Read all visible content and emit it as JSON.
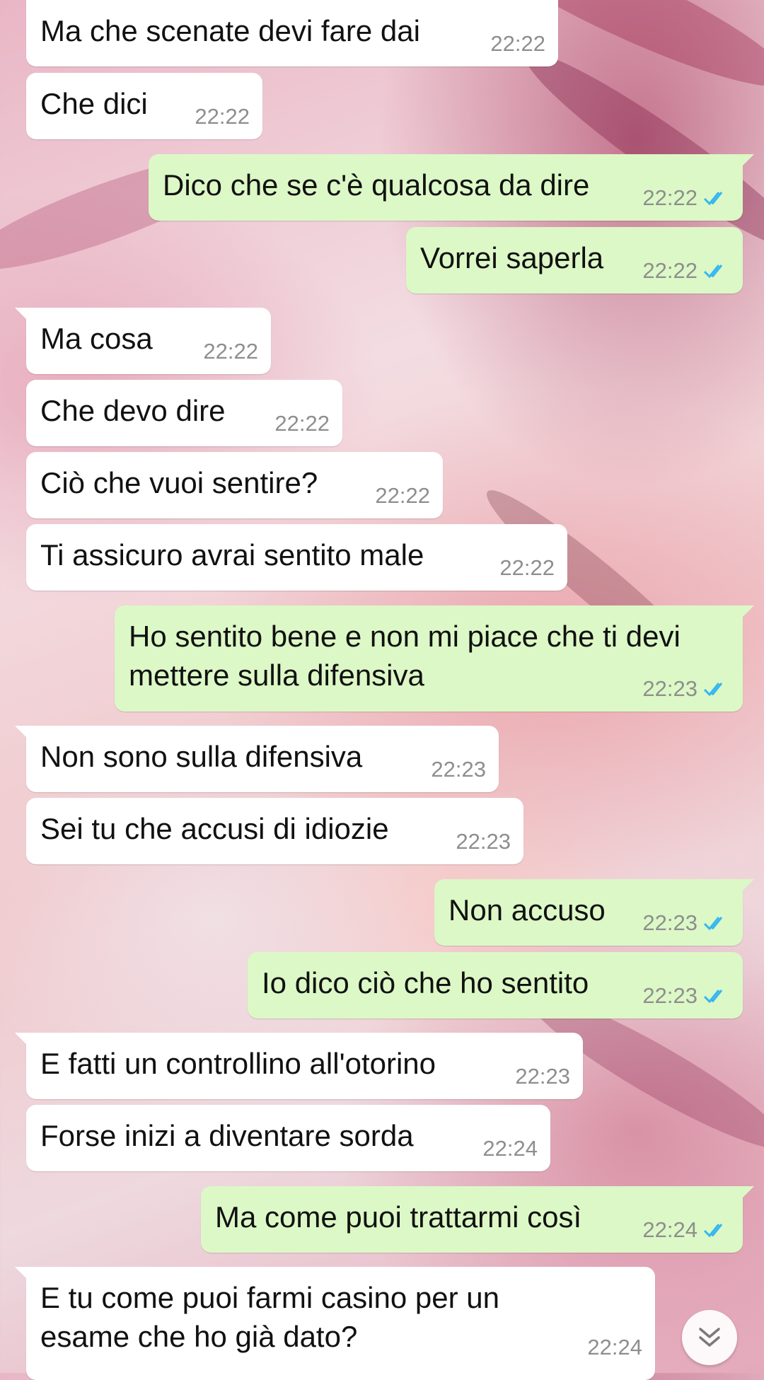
{
  "messages": [
    {
      "dir": "in",
      "text": "Ma che scenate devi fare dai",
      "time": "22:22",
      "tail": false
    },
    {
      "dir": "in",
      "text": "Che dici",
      "time": "22:22",
      "tail": false
    },
    {
      "dir": "out",
      "text": "Dico che se c'è qualcosa da dire",
      "time": "22:22",
      "tail": true,
      "status": "read"
    },
    {
      "dir": "out",
      "text": "Vorrei saperla",
      "time": "22:22",
      "tail": false,
      "status": "read"
    },
    {
      "dir": "in",
      "text": "Ma cosa",
      "time": "22:22",
      "tail": true
    },
    {
      "dir": "in",
      "text": "Che devo dire",
      "time": "22:22",
      "tail": false
    },
    {
      "dir": "in",
      "text": "Ciò che vuoi sentire?",
      "time": "22:22",
      "tail": false
    },
    {
      "dir": "in",
      "text": "Ti assicuro avrai sentito male",
      "time": "22:22",
      "tail": false
    },
    {
      "dir": "out",
      "lines": [
        "Ho sentito bene e non mi piace che ti devi",
        "mettere sulla difensiva"
      ],
      "time": "22:23",
      "tail": true,
      "status": "read"
    },
    {
      "dir": "in",
      "text": "Non sono sulla difensiva",
      "time": "22:23",
      "tail": true
    },
    {
      "dir": "in",
      "text": "Sei tu che accusi di idiozie",
      "time": "22:23",
      "tail": false
    },
    {
      "dir": "out",
      "text": "Non accuso",
      "time": "22:23",
      "tail": true,
      "status": "read"
    },
    {
      "dir": "out",
      "text": "Io dico ciò che ho sentito",
      "time": "22:23",
      "tail": false,
      "status": "read"
    },
    {
      "dir": "in",
      "text": "E fatti un controllino all'otorino",
      "time": "22:23",
      "tail": true
    },
    {
      "dir": "in",
      "text": "Forse inizi a diventare sorda",
      "time": "22:24",
      "tail": false
    },
    {
      "dir": "out",
      "text": "Ma come puoi trattarmi così",
      "time": "22:24",
      "tail": true,
      "status": "read"
    },
    {
      "dir": "in",
      "lines": [
        "E tu come puoi farmi casino per un",
        "esame che ho già dato?"
      ],
      "time": "22:24",
      "tail": true
    }
  ],
  "colors": {
    "incoming": "#ffffff",
    "outgoing": "#dcf8c6",
    "read_ticks": "#34b7f1",
    "time": "#8e8e8e"
  },
  "icons": {
    "read_status": "double-check-icon",
    "scroll_down": "chevron-double-down-icon"
  }
}
